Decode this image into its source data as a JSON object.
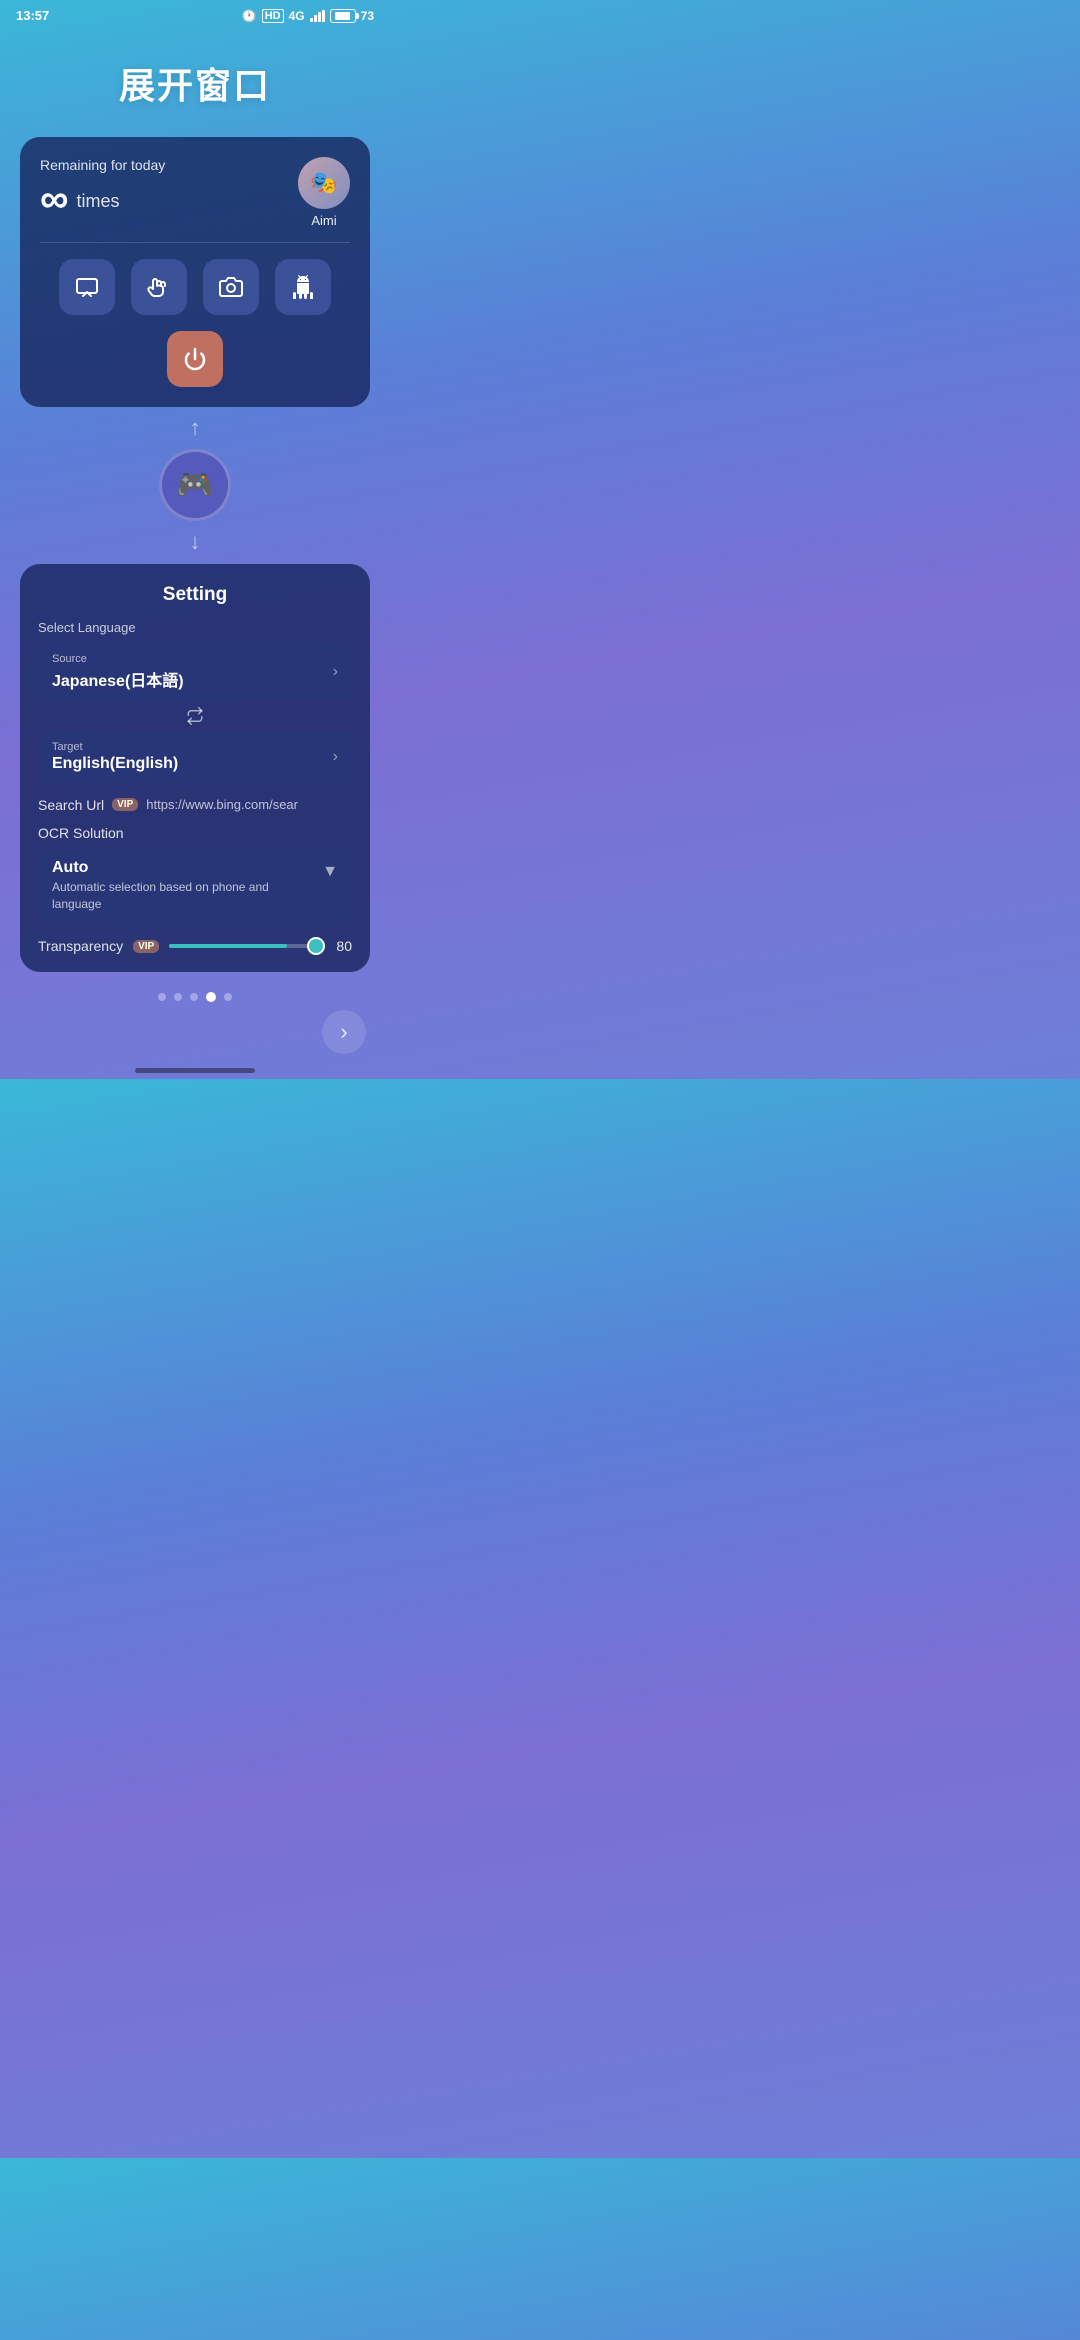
{
  "statusBar": {
    "time": "13:57",
    "hdLabel": "HD",
    "networkType": "4G",
    "batteryLevel": "73"
  },
  "pageTitle": "展开窗口",
  "topCard": {
    "remainingLabel": "Remaining for today",
    "infinitySymbol": "∞",
    "timesLabel": "times",
    "avatarEmoji": "🎭",
    "avatarName": "Aimi"
  },
  "actionButtons": [
    {
      "id": "screen-btn",
      "icon": "⬛",
      "label": "screen"
    },
    {
      "id": "touch-btn",
      "icon": "👆",
      "label": "touch"
    },
    {
      "id": "camera-btn",
      "icon": "📷",
      "label": "camera"
    },
    {
      "id": "android-btn",
      "icon": "🤖",
      "label": "android"
    }
  ],
  "powerButton": {
    "icon": "⏻",
    "label": "power"
  },
  "appIcon": {
    "emoji": "🎮",
    "label": "app-icon"
  },
  "settingCard": {
    "title": "Setting",
    "selectLanguageLabel": "Select Language",
    "sourceLabel": "Source",
    "sourceValue": "Japanese(日本語)",
    "targetLabel": "Target",
    "targetValue": "English(English)",
    "searchUrlLabel": "Search Url",
    "searchUrlVip": "VIP",
    "searchUrlValue": "https://www.bing.com/sear",
    "ocrSolutionLabel": "OCR Solution",
    "ocrMainValue": "Auto",
    "ocrSubValue": "Automatic selection based on phone and language",
    "transparencyLabel": "Transparency",
    "transparencyVip": "VIP",
    "transparencyValue": "80",
    "transparencyPercent": 80
  },
  "pageDots": {
    "count": 5,
    "activeIndex": 3
  },
  "nextButton": {
    "icon": "›"
  }
}
